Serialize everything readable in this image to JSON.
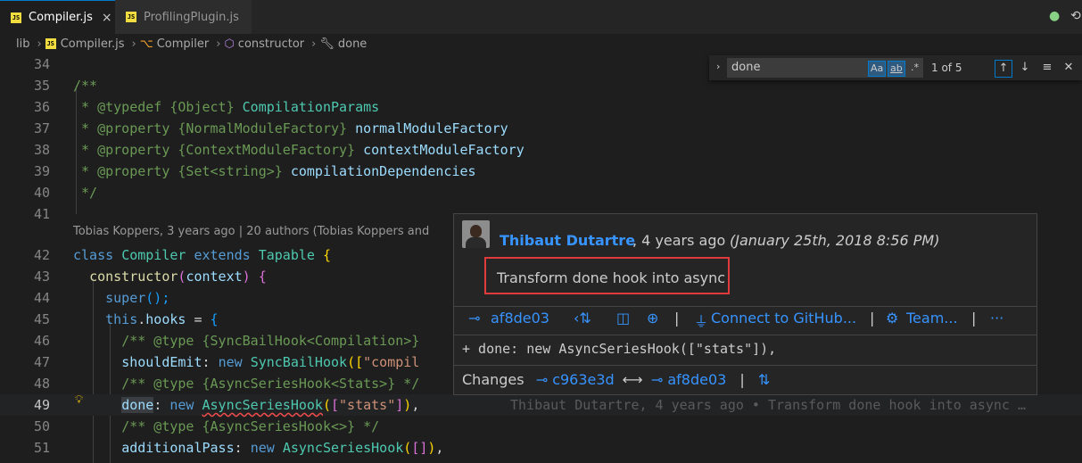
{
  "tabs": [
    {
      "label": "Compiler.js",
      "badge": "JS",
      "active": true,
      "close": "×"
    },
    {
      "label": "ProfilingPlugin.js",
      "badge": "JS",
      "active": false
    }
  ],
  "breadcrumb": {
    "items": [
      "lib",
      "Compiler.js",
      "Compiler",
      "constructor",
      "done"
    ],
    "separator": "›"
  },
  "find": {
    "value": "done",
    "match_case": "Aa",
    "whole_word": "ab",
    "regex": ".*",
    "count": "1 of 5"
  },
  "code_lines": [
    {
      "n": "34"
    },
    {
      "n": "35"
    },
    {
      "n": "36"
    },
    {
      "n": "37"
    },
    {
      "n": "38"
    },
    {
      "n": "39"
    },
    {
      "n": "40"
    },
    {
      "n": "41"
    },
    {
      "n": "42"
    },
    {
      "n": "43"
    },
    {
      "n": "44"
    },
    {
      "n": "45"
    },
    {
      "n": "46"
    },
    {
      "n": "47"
    },
    {
      "n": "48"
    },
    {
      "n": "49"
    },
    {
      "n": "50"
    },
    {
      "n": "51"
    }
  ],
  "code": {
    "l35": "/**",
    "l36_a": " * @typedef {Object} ",
    "l36_b": "CompilationParams",
    "l37_a": " * @property {NormalModuleFactory} ",
    "l37_b": "normalModuleFactory",
    "l38_a": " * @property {ContextModuleFactory} ",
    "l38_b": "contextModuleFactory",
    "l39_a": " * @property {Set<string>} ",
    "l39_b": "compilationDependencies",
    "l40": " */",
    "l42_kw1": "class",
    "l42_cls1": "Compiler",
    "l42_kw2": "extends",
    "l42_cls2": "Tapable",
    "l42_br": "{",
    "l43_fn": "constructor",
    "l43_p1": "(",
    "l43_arg": "context",
    "l43_p2": ")",
    "l43_br": "{",
    "l44_fn": "super",
    "l44_p": "();",
    "l45_kw": "this",
    "l45_dot": ".",
    "l45_prop": "hooks",
    "l45_eq": " = ",
    "l45_br": "{",
    "l46": "/** @type {SyncBailHook<Compilation>}",
    "l47_prop": "shouldEmit",
    "l47_c": ": ",
    "l47_kw": "new",
    "l47_cls": "SyncBailHook",
    "l47_p": "([",
    "l47_str": "\"compil",
    "l48": "/** @type {AsyncSeriesHook<Stats>} */",
    "l49_prop": "done",
    "l49_c": ": ",
    "l49_kw": "new",
    "l49_cls": "AsyncSeriesHook",
    "l49_p1": "(",
    "l49_p2": "[",
    "l49_str": "\"stats\"",
    "l49_p3": "]",
    "l49_p4": ")",
    "l49_end": ",",
    "l50": "/** @type {AsyncSeriesHook<>} */",
    "l51_prop": "additionalPass",
    "l51_c": ": ",
    "l51_kw": "new",
    "l51_cls": "AsyncSeriesHook",
    "l51_p1": "(",
    "l51_p2": "[",
    "l51_p3": "]",
    "l51_p4": ")",
    "l51_end": ","
  },
  "codelens": "Tobias Koppers, 3 years ago | 20 authors (Tobias Koppers and",
  "inline_blame": "Thibaut Dutartre, 4 years ago • Transform done hook into async …",
  "hover": {
    "author": "Thibaut Dutartre",
    "ago": ", 4 years ago",
    "date": "(January 25th, 2018 8:56 PM)",
    "message": "Transform done hook into async",
    "commit": "af8de03",
    "open_github": "Connect to GitHub...",
    "team": "Team...",
    "more": "···",
    "diff": "+ done: new AsyncSeriesHook([\"stats\"]),",
    "changes_label": "Changes",
    "changes_from": "c963e3d",
    "changes_arrow": "⟷",
    "changes_to": "af8de03",
    "pipe": "|"
  },
  "colors": {
    "accent": "#007acc",
    "link": "#3794ff",
    "highlight_border": "#e03a3a"
  }
}
